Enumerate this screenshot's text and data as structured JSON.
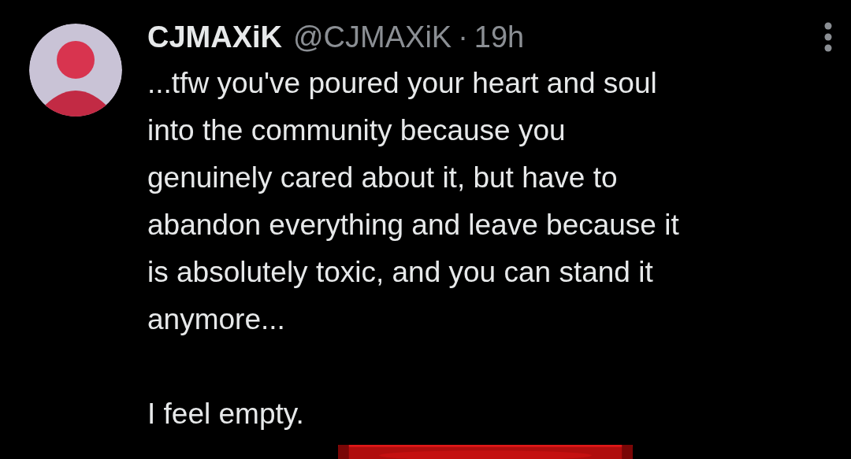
{
  "post": {
    "display_name": "CJMAXiK",
    "handle": "@CJMAXiK",
    "separator": "·",
    "time": "19h",
    "paragraphs": [
      "...tfw you've poured your heart and soul\ninto the community because you\ngenuinely cared about it, but have to\nabandon everything and leave because it\nis absolutely toxic, and you can stand it\nanymore...",
      "I feel empty."
    ]
  }
}
